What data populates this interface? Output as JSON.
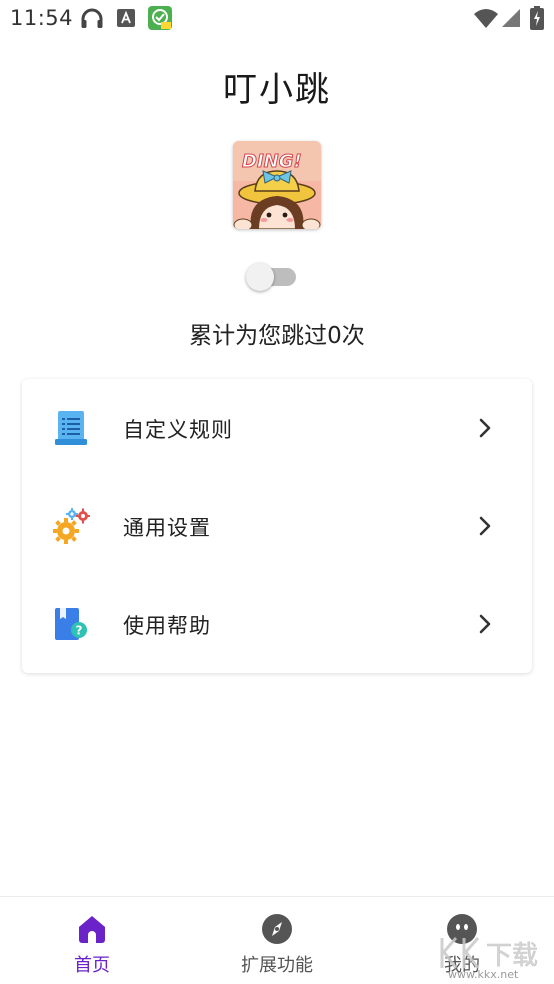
{
  "status_bar": {
    "time": "11:54"
  },
  "app": {
    "title": "叮小跳",
    "logo_text": "DING!",
    "skip_count_text": "累计为您跳过0次",
    "service_toggle": "off"
  },
  "menu": {
    "items": [
      {
        "label": "自定义规则",
        "icon": "document-list-icon"
      },
      {
        "label": "通用设置",
        "icon": "gears-icon"
      },
      {
        "label": "使用帮助",
        "icon": "help-book-icon"
      }
    ]
  },
  "bottom_nav": {
    "items": [
      {
        "label": "首页",
        "icon": "home-icon",
        "active": true
      },
      {
        "label": "扩展功能",
        "icon": "compass-icon",
        "active": false
      },
      {
        "label": "我的",
        "icon": "profile-icon",
        "active": false
      }
    ]
  },
  "watermark": {
    "text": "KK下载",
    "url": "www.kkx.net"
  },
  "colors": {
    "accent": "#6a22c9",
    "toggle_off": "#bdbdbd",
    "text": "#222222"
  }
}
